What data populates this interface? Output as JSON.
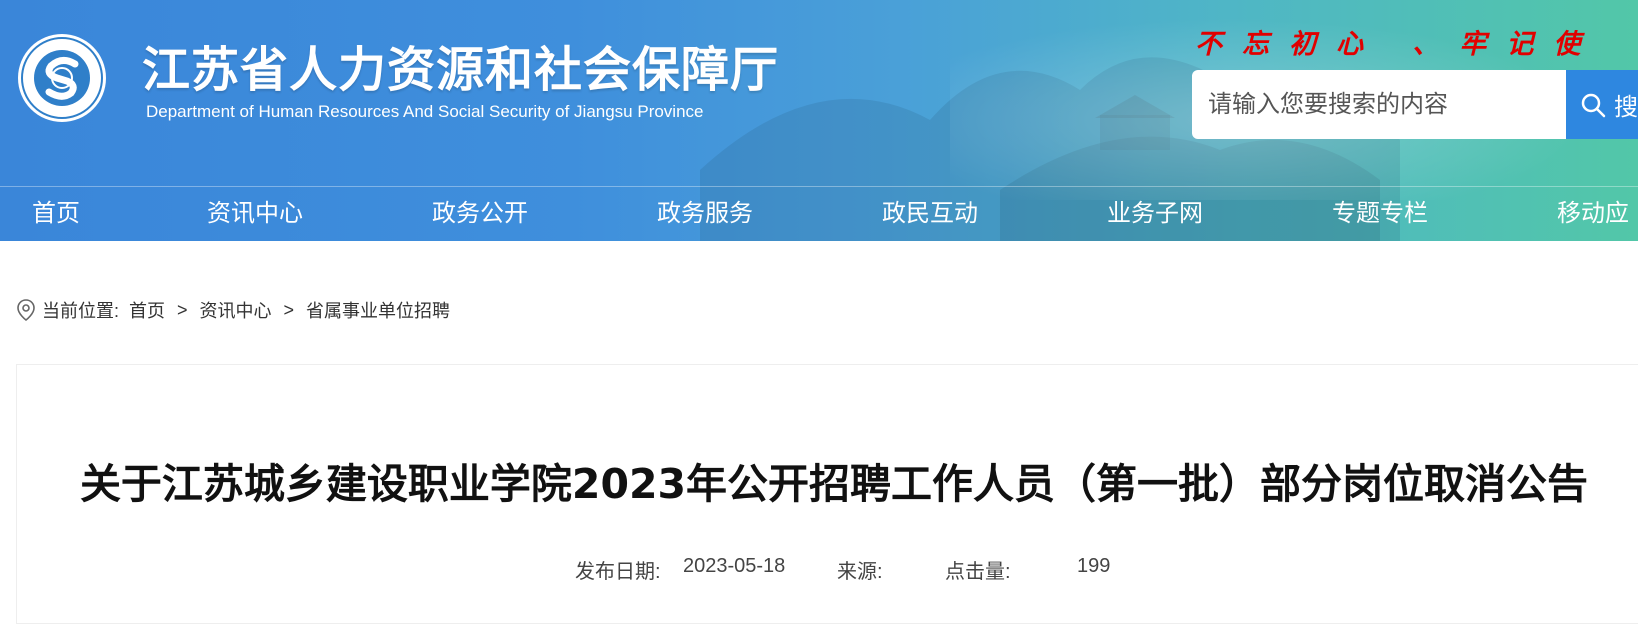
{
  "header": {
    "site_title": "江苏省人力资源和社会保障厅",
    "site_subtitle": "Department of Human Resources And Social Security of Jiangsu Province",
    "logo_text": "江苏省人力资源和社会保障厅",
    "slogan": "不忘初心 、牢记使",
    "search": {
      "placeholder": "请输入您要搜索的内容",
      "button_label": "搜"
    }
  },
  "nav": {
    "items": [
      {
        "label": "首页"
      },
      {
        "label": "资讯中心"
      },
      {
        "label": "政务公开"
      },
      {
        "label": "政务服务"
      },
      {
        "label": "政民互动"
      },
      {
        "label": "业务子网"
      },
      {
        "label": "专题专栏"
      },
      {
        "label": "移动应"
      }
    ]
  },
  "breadcrumb": {
    "prefix": "当前位置:",
    "items": [
      "首页",
      "资讯中心",
      "省属事业单位招聘"
    ],
    "separator": ">"
  },
  "article": {
    "title": "关于江苏城乡建设职业学院2023年公开招聘工作人员（第一批）部分岗位取消公告",
    "publish_date_label": "发布日期:",
    "publish_date": "2023-05-18",
    "source_label": "来源:",
    "views_label": "点击量:",
    "views": "199"
  },
  "colors": {
    "header_start": "#3a86d9",
    "header_end": "#52c7a8",
    "slogan": "#e10000",
    "search_button": "#2e87e0"
  }
}
